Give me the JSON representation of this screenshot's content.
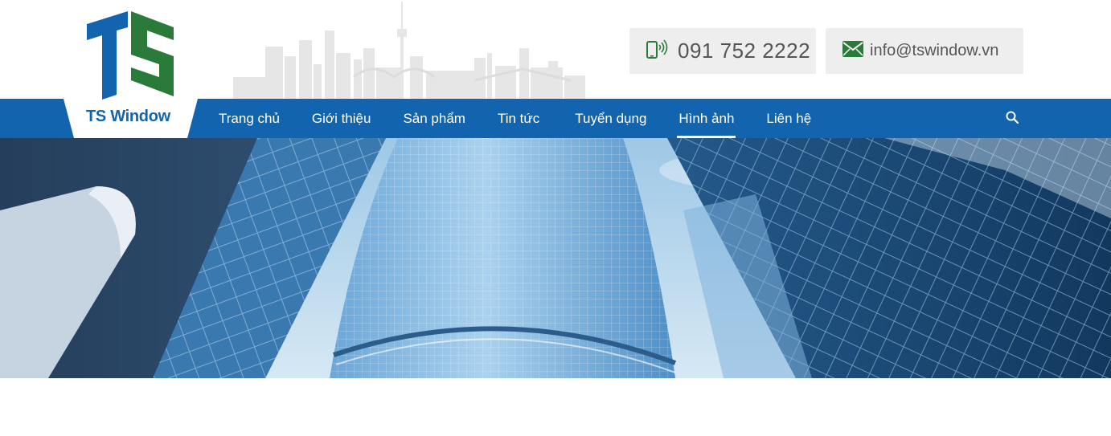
{
  "brand": {
    "name": "TS Window",
    "colors": {
      "blue": "#1164ad",
      "green": "#2a7a3a"
    }
  },
  "contact": {
    "phone": "091 752 2222",
    "phone_icon": "mobile-phone-icon",
    "email": "info@tswindow.vn",
    "email_icon": "envelope-icon"
  },
  "nav": {
    "items": [
      {
        "label": "Trang chủ",
        "active": false
      },
      {
        "label": "Giới thiệu",
        "active": false
      },
      {
        "label": "Sản phẩm",
        "active": false
      },
      {
        "label": "Tin tức",
        "active": false
      },
      {
        "label": "Tuyển dụng",
        "active": false
      },
      {
        "label": "Hình ảnh",
        "active": true
      },
      {
        "label": "Liên hệ",
        "active": false
      }
    ],
    "search_icon": "search-icon"
  },
  "banner": {
    "subject": "glass-skyscrapers-photo"
  }
}
